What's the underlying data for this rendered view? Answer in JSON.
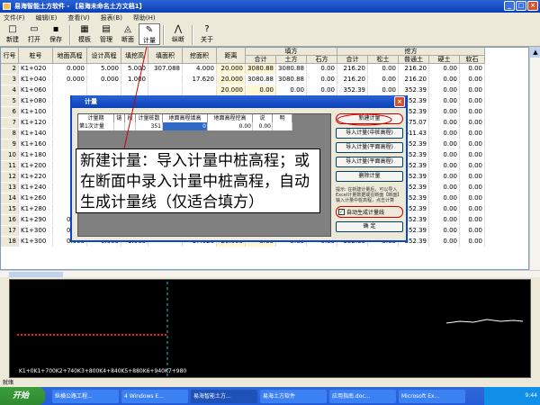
{
  "app": {
    "title": "易海智能土方软件 - 【易海未命名土方文档1】",
    "min": "_",
    "max": "□",
    "close": "×"
  },
  "menu": [
    "文件(F)",
    "编辑(E)",
    "查看(V)",
    "报表(B)",
    "帮助(H)"
  ],
  "toolbar": {
    "groups": [
      [
        {
          "label": "新建",
          "icon": "□"
        },
        {
          "label": "打开",
          "icon": "▭"
        },
        {
          "label": "保存",
          "icon": "▪"
        }
      ],
      [
        {
          "label": "模板",
          "icon": "▦"
        },
        {
          "label": "管理",
          "icon": "▤"
        },
        {
          "label": "断面",
          "icon": "◬"
        },
        {
          "label": "计量",
          "icon": "✎"
        }
      ],
      [
        {
          "label": "纵断",
          "icon": "⋀"
        }
      ],
      [
        {
          "label": "关于",
          "icon": "?"
        }
      ]
    ]
  },
  "table": {
    "headers": [
      {
        "label": "行号"
      },
      {
        "label": "桩号"
      },
      {
        "label": "地面高程"
      },
      {
        "label": "设计高程"
      },
      {
        "label": "填挖高"
      },
      {
        "label": "填面积"
      },
      {
        "label": "挖面积"
      },
      {
        "label": "距离"
      },
      {
        "label": "合计"
      },
      {
        "label": "土方"
      },
      {
        "label": "石方"
      },
      {
        "label": "合计"
      },
      {
        "label": "松土"
      },
      {
        "label": "普通土"
      },
      {
        "label": "硬土"
      },
      {
        "label": "软石"
      }
    ],
    "group_headers": [
      "填方",
      "挖方"
    ],
    "rows": [
      [
        "2",
        "K1+020",
        "0.000",
        "5.000",
        "5.000",
        "307.088",
        "4.000",
        "20.000",
        "3080.88",
        "3080.88",
        "0.00",
        "216.20",
        "0.00",
        "216.20",
        "0.00",
        "0.00"
      ],
      [
        "3",
        "K1+040",
        "0.000",
        "0.000",
        "1.000",
        "",
        "17.620",
        "20.000",
        "3080.88",
        "3080.88",
        "0.00",
        "216.20",
        "0.00",
        "216.20",
        "0.00",
        "0.00"
      ],
      [
        "4",
        "K1+060",
        "",
        "",
        "",
        "",
        "",
        "20.000",
        "0.00",
        "0.00",
        "0.00",
        "352.39",
        "0.00",
        "352.39",
        "0.00",
        "0.00"
      ],
      [
        "5",
        "K1+080",
        "",
        "",
        "",
        "",
        "",
        "20.000",
        "0.00",
        "0.00",
        "0.00",
        "352.39",
        "0.00",
        "352.39",
        "0.00",
        "0.00"
      ],
      [
        "6",
        "K1+100",
        "",
        "",
        "",
        "",
        "",
        "20.000",
        "0.00",
        "0.00",
        "0.00",
        "352.39",
        "0.00",
        "352.39",
        "0.00",
        "0.00"
      ],
      [
        "7",
        "K1+120",
        "",
        "",
        "",
        "",
        "",
        "20.000",
        "0.00",
        "0.00",
        "0.00",
        "475.07",
        "0.00",
        "475.07",
        "0.00",
        "0.00"
      ],
      [
        "8",
        "K1+140",
        "",
        "",
        "",
        "",
        "",
        "20.000",
        "0.00",
        "0.00",
        "0.00",
        "611.43",
        "0.00",
        "611.43",
        "0.00",
        "0.00"
      ],
      [
        "9",
        "K1+160",
        "",
        "",
        "",
        "",
        "",
        "20.000",
        "0.00",
        "0.00",
        "0.00",
        "352.39",
        "0.00",
        "352.39",
        "0.00",
        "0.00"
      ],
      [
        "10",
        "K1+180",
        "",
        "",
        "",
        "",
        "",
        "20.000",
        "0.00",
        "0.00",
        "0.00",
        "352.39",
        "0.00",
        "352.39",
        "0.00",
        "0.00"
      ],
      [
        "11",
        "K1+200",
        "",
        "",
        "",
        "",
        "",
        "20.000",
        "0.00",
        "0.00",
        "0.00",
        "352.39",
        "0.00",
        "352.39",
        "0.00",
        "0.00"
      ],
      [
        "12",
        "K1+220",
        "",
        "",
        "",
        "",
        "",
        "20.000",
        "0.00",
        "0.00",
        "0.00",
        "352.39",
        "0.00",
        "352.39",
        "0.00",
        "0.00"
      ],
      [
        "13",
        "K1+240",
        "",
        "",
        "",
        "",
        "",
        "20.000",
        "0.00",
        "0.00",
        "0.00",
        "352.39",
        "0.00",
        "352.39",
        "0.00",
        "0.00"
      ],
      [
        "14",
        "K1+260",
        "",
        "",
        "",
        "",
        "",
        "20.000",
        "0.00",
        "0.00",
        "0.00",
        "352.39",
        "0.00",
        "352.39",
        "0.00",
        "0.00"
      ],
      [
        "15",
        "K1+280",
        "",
        "",
        "",
        "",
        "",
        "20.000",
        "0.00",
        "0.00",
        "0.00",
        "352.39",
        "0.00",
        "352.39",
        "0.00",
        "0.00"
      ],
      [
        "16",
        "K1+290",
        "0.000",
        "0.000",
        "1.000",
        "",
        "17.620",
        "20.000",
        "0.00",
        "0.00",
        "0.00",
        "352.39",
        "0.00",
        "352.39",
        "0.00",
        "0.00"
      ],
      [
        "17",
        "K1+300",
        "0.000",
        "0.000",
        "1.000",
        "",
        "17.620",
        "20.000",
        "0.00",
        "0.00",
        "0.00",
        "352.39",
        "0.00",
        "352.39",
        "0.00",
        "0.00"
      ],
      [
        "18",
        "K1+300",
        "0.000",
        "0.000",
        "1.000",
        "",
        "17.620",
        "20.000",
        "0.00",
        "0.00",
        "0.00",
        "352.39",
        "0.00",
        "352.39",
        "0.00",
        "0.00"
      ]
    ]
  },
  "dialog": {
    "title": "计量",
    "headers": [
      "计量期",
      "链",
      "段",
      "计量桩数",
      "地面高程填高",
      "地面高程挖高",
      "说",
      "明"
    ],
    "row": [
      "第1次计量",
      "",
      "",
      "351",
      "0",
      "0.00",
      "0.00",
      ""
    ],
    "buttons": [
      "新建计量",
      "导入计量(中桩高程)",
      "导入计量(平面高程)",
      "导入计量(平面高程)",
      "删除计量"
    ],
    "tip": "提示: 在新建计量后，可以导入Excel计量数据或在断面【断面】输入计量中桩高程，点击计算",
    "checkbox_label": "自动生成计量线",
    "ok": "确 定"
  },
  "annotation": "新建计量：导入计量中桩高程；或在断面中录入计量中桩高程，自动生成计量线（仅适合填方）",
  "section_caption": "K1+0K1+700K2+740K3+800K4+840K5+880K6+940K7+980",
  "status": "就绪",
  "taskbar": {
    "start": "开始",
    "tasks": [
      "纵横公路工程...",
      "4 Windows E...",
      "易海智能土方...",
      "易海土方软件",
      "应用指南.doc...",
      "Microsoft Ex..."
    ],
    "clock": "9:44"
  },
  "colors": {
    "title": "#0a3fb5",
    "accent": "#c00000",
    "grid_bg": "#ffffff"
  }
}
